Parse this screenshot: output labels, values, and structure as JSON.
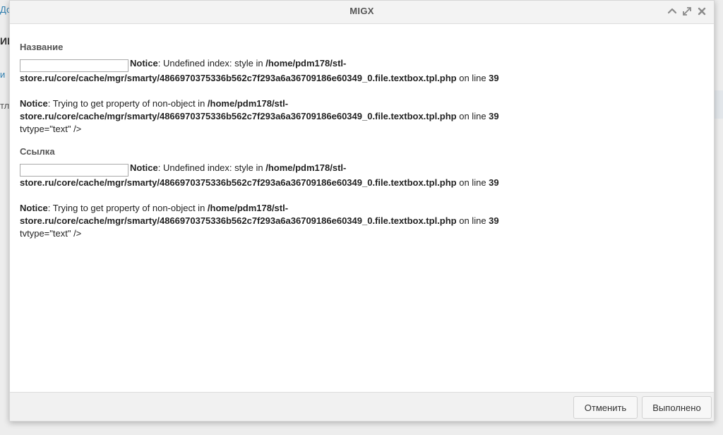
{
  "background": {
    "link_fragment": "До",
    "heading_fragment": "ИИ",
    "tab_fragment": "и",
    "row_fragment": "тл"
  },
  "window": {
    "title": "MIGX"
  },
  "fields": [
    {
      "label": "Название",
      "input_value": "",
      "notice1": {
        "level": "Notice",
        "message": ": Undefined index: style in ",
        "path": "/home/pdm178/stl-store.ru/core/cache/mgr/smarty/4866970375336b562c7f293a6a36709186e60349_0.file.textbox.tpl.php",
        "on_line": " on line ",
        "line": "39"
      },
      "notice2": {
        "level": "Notice",
        "message": ": Trying to get property of non-object in ",
        "path": "/home/pdm178/stl-store.ru/core/cache/mgr/smarty/4866970375336b562c7f293a6a36709186e60349_0.file.textbox.tpl.php",
        "on_line": " on line ",
        "line": "39"
      },
      "tail": "tvtype=\"text\" />"
    },
    {
      "label": "Ссылка",
      "input_value": "",
      "notice1": {
        "level": "Notice",
        "message": ": Undefined index: style in ",
        "path": "/home/pdm178/stl-store.ru/core/cache/mgr/smarty/4866970375336b562c7f293a6a36709186e60349_0.file.textbox.tpl.php",
        "on_line": " on line ",
        "line": "39"
      },
      "notice2": {
        "level": "Notice",
        "message": ": Trying to get property of non-object in ",
        "path": "/home/pdm178/stl-store.ru/core/cache/mgr/smarty/4866970375336b562c7f293a6a36709186e60349_0.file.textbox.tpl.php",
        "on_line": " on line ",
        "line": "39"
      },
      "tail": "tvtype=\"text\" />"
    }
  ],
  "footer": {
    "cancel_label": "Отменить",
    "ok_label": "Выполнено"
  },
  "icons": {
    "collapse": "chevron-up-icon",
    "maximize": "expand-icon",
    "close": "close-icon"
  }
}
